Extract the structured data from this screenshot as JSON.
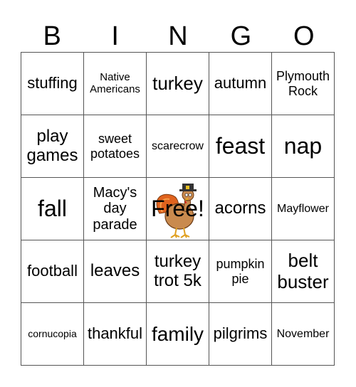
{
  "header": {
    "letters": [
      "B",
      "I",
      "N",
      "G",
      "O"
    ]
  },
  "grid": {
    "rows": [
      [
        "stuffing",
        "Native Americans",
        "turkey",
        "autumn",
        "Plymouth Rock"
      ],
      [
        "play games",
        "sweet potatoes",
        "scarecrow",
        "feast",
        "nap"
      ],
      [
        "fall",
        "Macy's day parade",
        "Free!",
        "acorns",
        "Mayflower"
      ],
      [
        "football",
        "leaves",
        "turkey trot 5k",
        "pumpkin pie",
        "belt buster"
      ],
      [
        "cornucopia",
        "thankful",
        "family",
        "pilgrims",
        "November"
      ]
    ],
    "free_icon": "pilgrim-turkey-icon"
  }
}
